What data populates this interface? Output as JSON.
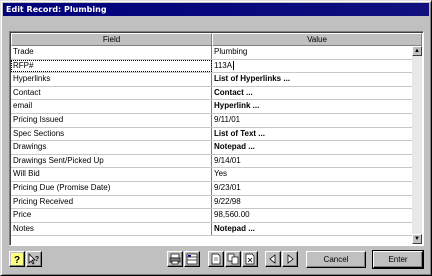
{
  "window": {
    "title": "Edit Record: Plumbing"
  },
  "grid": {
    "columns": {
      "field": "Field",
      "value": "Value"
    },
    "rows": [
      {
        "field": "Trade",
        "value": "Plumbing",
        "bold": false
      },
      {
        "field": "RFP#",
        "value": "113A",
        "bold": false,
        "editing": true
      },
      {
        "field": "Hyperlinks",
        "value": "List of Hyperlinks ...",
        "bold": true
      },
      {
        "field": "Contact",
        "value": "Contact ...",
        "bold": true
      },
      {
        "field": "email",
        "value": "Hyperlink ...",
        "bold": true
      },
      {
        "field": "Pricing Issued",
        "value": "9/11/01",
        "bold": false
      },
      {
        "field": "Spec Sections",
        "value": "List of Text ...",
        "bold": true
      },
      {
        "field": "Drawings",
        "value": "Notepad ...",
        "bold": true
      },
      {
        "field": "Drawings Sent/Picked Up",
        "value": "9/14/01",
        "bold": false
      },
      {
        "field": "Will Bid",
        "value": "Yes",
        "bold": false
      },
      {
        "field": "Pricing Due (Promise Date)",
        "value": "9/23/01",
        "bold": false
      },
      {
        "field": "Pricing Received",
        "value": "9/22/98",
        "bold": false
      },
      {
        "field": "Price",
        "value": "98,560.00",
        "bold": false
      },
      {
        "field": "Notes",
        "value": "Notepad ...",
        "bold": true
      }
    ]
  },
  "buttons": {
    "cancel": "Cancel",
    "enter": "Enter"
  }
}
